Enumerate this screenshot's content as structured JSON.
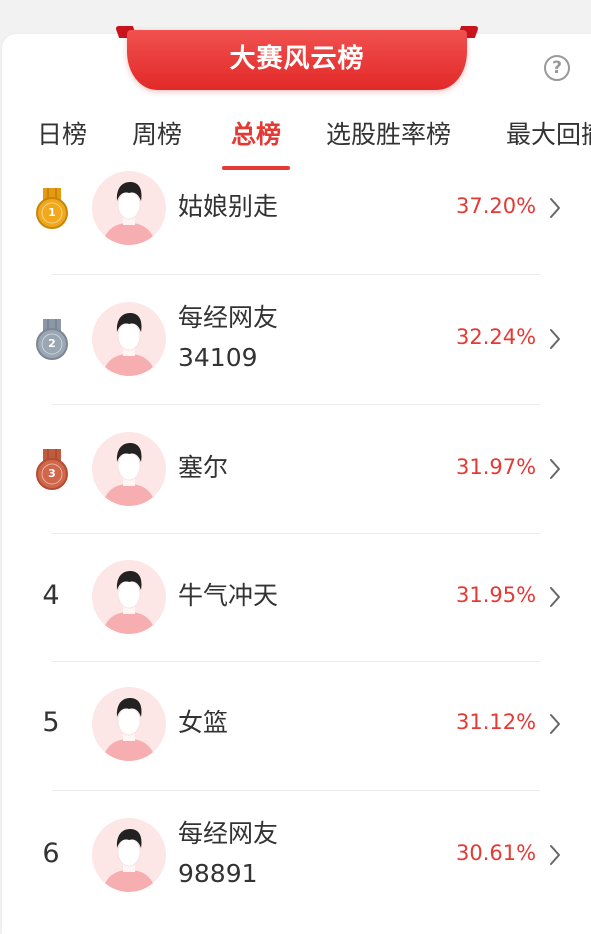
{
  "header": {
    "title": "大赛风云榜",
    "help_glyph": "?"
  },
  "tabs": [
    {
      "label": "日榜",
      "active": false
    },
    {
      "label": "周榜",
      "active": false
    },
    {
      "label": "总榜",
      "active": true
    },
    {
      "label": "选股胜率榜",
      "active": false
    },
    {
      "label": "最大回撤",
      "active": false
    }
  ],
  "rows": [
    {
      "rank": "1",
      "medal": "gold",
      "name": "姑娘别走",
      "name2": "",
      "pct": "37.20%"
    },
    {
      "rank": "2",
      "medal": "silver",
      "name": "每经网友",
      "name2": "34109",
      "pct": "32.24%"
    },
    {
      "rank": "3",
      "medal": "bronze",
      "name": "塞尔",
      "name2": "",
      "pct": "31.97%"
    },
    {
      "rank": "4",
      "medal": "",
      "name": "牛气冲天",
      "name2": "",
      "pct": "31.95%"
    },
    {
      "rank": "5",
      "medal": "",
      "name": "女篮",
      "name2": "",
      "pct": "31.12%"
    },
    {
      "rank": "6",
      "medal": "",
      "name": "每经网友",
      "name2": "98891",
      "pct": "30.61%"
    }
  ],
  "colors": {
    "accent": "#e53935",
    "gold": "#f0a81c",
    "silver": "#9aa6b3",
    "bronze": "#d0674a"
  }
}
